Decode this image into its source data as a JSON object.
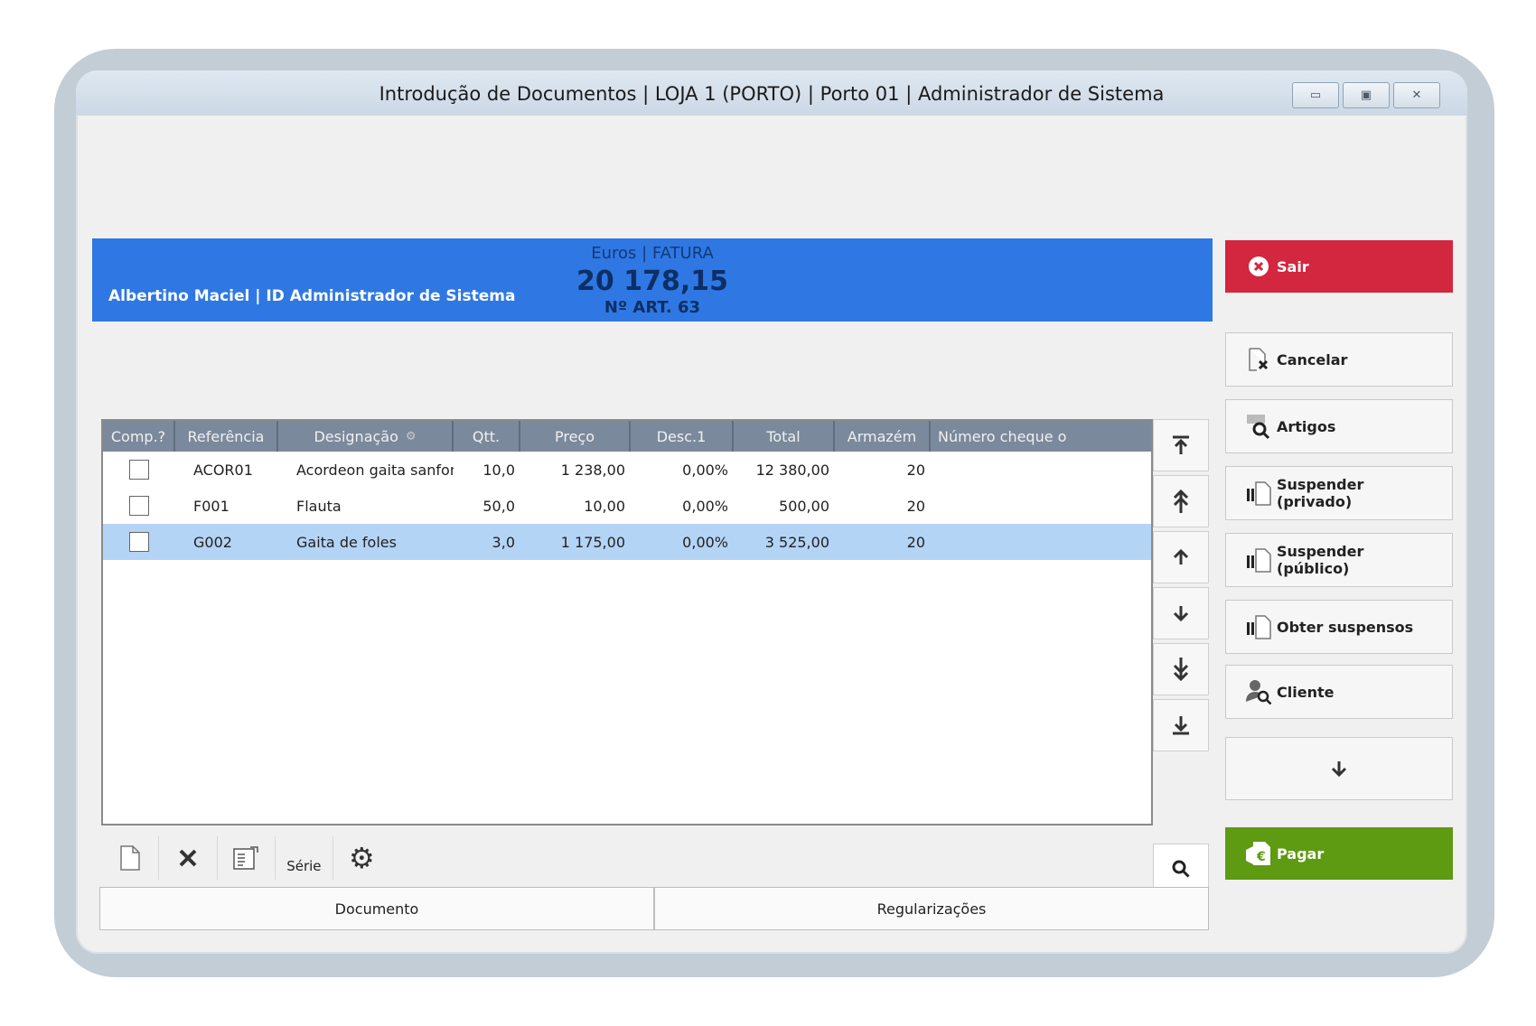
{
  "window": {
    "title": "Introdução de Documentos | LOJA 1 (PORTO) | Porto 01 | Administrador de Sistema",
    "buttons": [
      "minimize",
      "maximize",
      "close"
    ]
  },
  "banner": {
    "doc_type": "Euros | FATURA",
    "total": "20 178,15",
    "articles": "Nº ART. 63",
    "user": "Albertino Maciel | ID Administrador de Sistema"
  },
  "grid": {
    "columns": [
      "Comp.?",
      "Referência",
      "Designação",
      "Qtt.",
      "Preço",
      "Desc.1",
      "Total",
      "Armazém",
      "Número cheque o"
    ],
    "rows": [
      {
        "ref": "ACOR01",
        "des": "Acordeon gaita sanfona",
        "qtt": "10,0",
        "preco": "1 238,00",
        "desc": "0,00%",
        "total": "12 380,00",
        "arm": "20",
        "selected": false
      },
      {
        "ref": "F001",
        "des": "Flauta",
        "qtt": "50,0",
        "preco": "10,00",
        "desc": "0,00%",
        "total": "500,00",
        "arm": "20",
        "selected": false
      },
      {
        "ref": "G002",
        "des": "Gaita de foles",
        "qtt": "3,0",
        "preco": "1 175,00",
        "desc": "0,00%",
        "total": "3 525,00",
        "arm": "20",
        "selected": true
      }
    ]
  },
  "toolbar": {
    "serie_label": "Série"
  },
  "tabs": [
    "Documento",
    "Regularizações"
  ],
  "side": {
    "sair": "Sair",
    "cancelar": "Cancelar",
    "artigos": "Artigos",
    "suspender_privado": [
      "Suspender",
      "(privado)"
    ],
    "suspender_publico": [
      "Suspender",
      "(público)"
    ],
    "obter_suspensos": "Obter suspensos",
    "cliente": "Cliente",
    "pagar": "Pagar"
  },
  "colors": {
    "banner": "#2f78e3",
    "sair": "#d3263f",
    "pagar": "#5e9a12",
    "selected_row": "#b4d4f5",
    "grid_header": "#7a8a9c"
  }
}
